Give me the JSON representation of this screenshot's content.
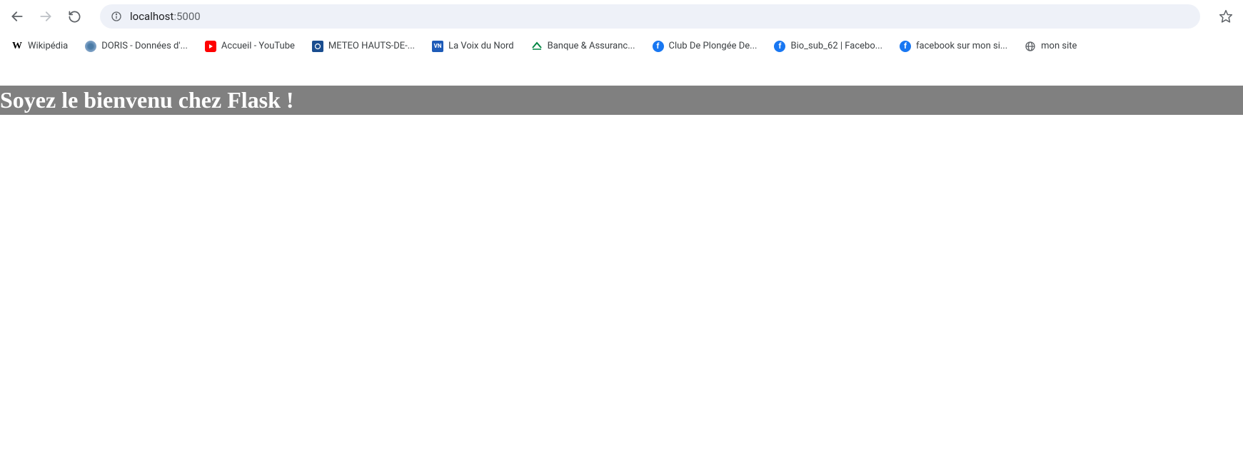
{
  "toolbar": {
    "url_host": "localhost",
    "url_port": ":5000"
  },
  "bookmarks": [
    {
      "label": "Wikipédia",
      "icon": "wiki"
    },
    {
      "label": "DORIS - Données d'...",
      "icon": "doris"
    },
    {
      "label": "Accueil - YouTube",
      "icon": "youtube"
    },
    {
      "label": "METEO HAUTS-DE-...",
      "icon": "meteo"
    },
    {
      "label": "La Voix du Nord",
      "icon": "voix"
    },
    {
      "label": "Banque & Assuranc...",
      "icon": "banque"
    },
    {
      "label": "Club De Plongée De...",
      "icon": "facebook"
    },
    {
      "label": "Bio_sub_62 | Facebo...",
      "icon": "facebook"
    },
    {
      "label": "facebook sur mon si...",
      "icon": "facebook"
    },
    {
      "label": "mon site",
      "icon": "globe"
    }
  ],
  "page": {
    "heading": "Soyez le bienvenu chez Flask !"
  }
}
